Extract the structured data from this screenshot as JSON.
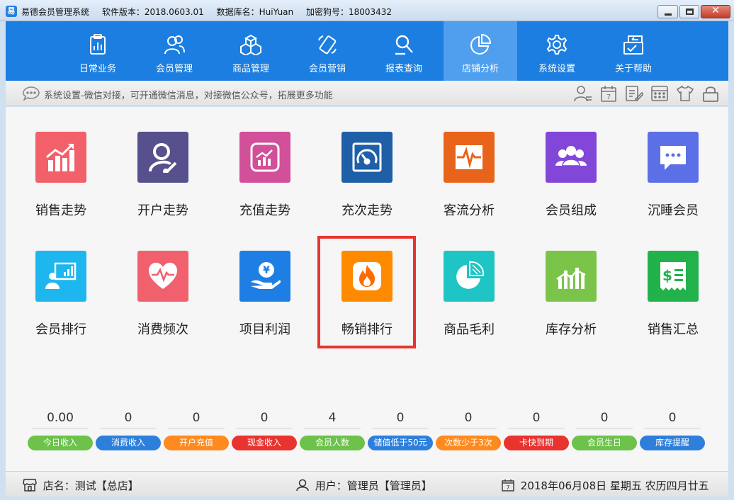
{
  "titlebar": {
    "app_name": "易德会员管理系统",
    "version": "软件版本：2018.0603.01",
    "database": "数据库名：HuiYuan",
    "dongle": "加密狗号：18003432"
  },
  "nav": [
    {
      "label": "日常业务",
      "icon": "clipboard-icon"
    },
    {
      "label": "会员管理",
      "icon": "users-icon"
    },
    {
      "label": "商品管理",
      "icon": "boxes-icon"
    },
    {
      "label": "会员营销",
      "icon": "phone-icon"
    },
    {
      "label": "报表查询",
      "icon": "search-report-icon"
    },
    {
      "label": "店铺分析",
      "icon": "pie-chart-icon",
      "active": true
    },
    {
      "label": "系统设置",
      "icon": "gear-icon"
    },
    {
      "label": "关于帮助",
      "icon": "help-icon"
    }
  ],
  "infobar": {
    "message": "系统设置-微信对接，可开通微信消息，对接微信公众号，拓展更多功能",
    "tools": [
      "member-card-icon",
      "calendar-icon",
      "edit-list-icon",
      "calculator-icon",
      "shirt-icon",
      "lock-icon"
    ],
    "calendar_day": "7"
  },
  "tiles": [
    {
      "label": "销售走势",
      "color": "#f2606a",
      "icon": "sales-trend-icon"
    },
    {
      "label": "开户走势",
      "color": "#56508c",
      "icon": "account-open-icon"
    },
    {
      "label": "充值走势",
      "color": "#d24f9a",
      "icon": "recharge-trend-icon"
    },
    {
      "label": "充次走势",
      "color": "#1e5fa7",
      "icon": "gauge-icon"
    },
    {
      "label": "客流分析",
      "color": "#e8641b",
      "icon": "pulse-icon"
    },
    {
      "label": "会员组成",
      "color": "#8246d8",
      "icon": "group-icon"
    },
    {
      "label": "沉睡会员",
      "color": "#5b70e6",
      "icon": "chat-icon"
    },
    {
      "label": "会员排行",
      "color": "#1db6ee",
      "icon": "presenter-icon"
    },
    {
      "label": "消费频次",
      "color": "#f1606d",
      "icon": "heartbeat-icon"
    },
    {
      "label": "项目利润",
      "color": "#1e7ee3",
      "icon": "coin-hand-icon"
    },
    {
      "label": "畅销排行",
      "color": "#ff8a00",
      "icon": "flame-icon"
    },
    {
      "label": "商品毛利",
      "color": "#1fc4c4",
      "icon": "pie-icon"
    },
    {
      "label": "库存分析",
      "color": "#7bc44a",
      "icon": "bar-chart-icon"
    },
    {
      "label": "销售汇总",
      "color": "#22b24c",
      "icon": "receipt-icon"
    }
  ],
  "stats": [
    {
      "value": "0.00",
      "label": "今日收入",
      "color": "#6cc24a"
    },
    {
      "value": "0",
      "label": "消费收入",
      "color": "#2e7fdb"
    },
    {
      "value": "0",
      "label": "开户充值",
      "color": "#ff8a1f"
    },
    {
      "value": "0",
      "label": "现金收入",
      "color": "#e8332f"
    },
    {
      "value": "4",
      "label": "会员人数",
      "color": "#6cc24a"
    },
    {
      "value": "0",
      "label": "储值低于50元",
      "color": "#2e7fdb"
    },
    {
      "value": "0",
      "label": "次数少于3次",
      "color": "#ff8a1f"
    },
    {
      "value": "0",
      "label": "卡快到期",
      "color": "#e8332f"
    },
    {
      "value": "0",
      "label": "会员生日",
      "color": "#6cc24a"
    },
    {
      "value": "0",
      "label": "库存提醒",
      "color": "#2e7fdb"
    }
  ],
  "status": {
    "store": "店名：测试【总店】",
    "user": "用户：管理员【管理员】",
    "date": "2018年06月08日 星期五 农历四月廿五",
    "calendar_day": "7"
  }
}
